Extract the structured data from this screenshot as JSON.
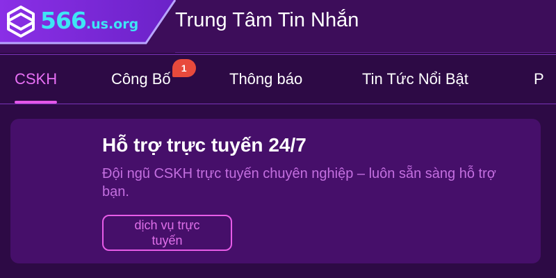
{
  "header": {
    "logo": {
      "number": "566",
      "domain": ".us.org"
    },
    "title": "Trung Tâm Tin Nhắn"
  },
  "tabs": [
    {
      "label": "CSKH",
      "active": true
    },
    {
      "label": "Công Bố",
      "badge": "1"
    },
    {
      "label": "Thông báo"
    },
    {
      "label": "Tin Tức Nổi Bật"
    },
    {
      "label": "P"
    }
  ],
  "card": {
    "title": "Hỗ trợ trực tuyến 24/7",
    "description": "Đội ngũ CSKH trực tuyến chuyên nghiệp – luôn sẵn sàng hỗ trợ bạn.",
    "button_label": "dịch vụ trực tuyến"
  },
  "colors": {
    "background": "#2d0a45",
    "header": "#3d0d5a",
    "logo_panel": "#7b2bd8",
    "accent": "#e457e9",
    "badge": "#e84a3c",
    "logo_text": "#3ee6f5",
    "card": "#460f6a"
  }
}
